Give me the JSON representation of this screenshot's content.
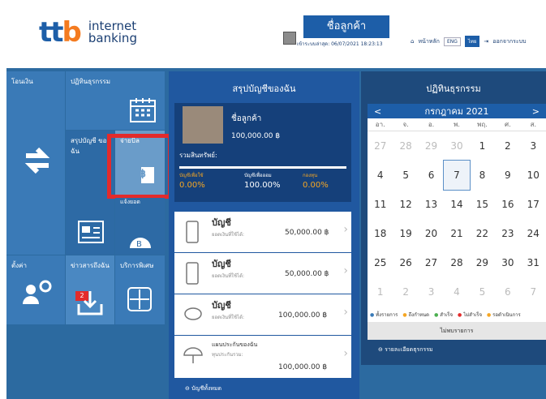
{
  "header": {
    "logo_main": "ttb",
    "logo_sub1": "internet",
    "logo_sub2": "banking",
    "customer_name": "ชื่อลูกค้า",
    "last_login": "เข้าระบบล่าสุด: 06/07/2021 18:23:13",
    "home": "หน้าหลัก",
    "lang_en": "ENG",
    "lang_th": "ไทย",
    "logout": "ออกจากระบบ"
  },
  "tiles": {
    "transfer": "โอนเงิน",
    "transactions": "ปฏิทินธุรกรรม",
    "summary": "สรุปบัญชี ของฉัน",
    "paybill": "จ่ายบิล",
    "settings": "ตั้งค่า",
    "news": "ข่าวสารถึงฉัน",
    "services": "บริการพิเศษ",
    "news_badge": "2",
    "partial": "แจ้งยอด"
  },
  "summary": {
    "title": "สรุปบัญชีของฉัน",
    "name": "ชื่อลูกค้า",
    "amount": "100,000.00 ฿",
    "assets_label": "รวมสินทรัพย์:",
    "c1": "บัญชีเพื่อใช้",
    "c2": "บัญชีเพื่อออม",
    "c3": "กองทุน",
    "p1": "0.00%",
    "p2": "100.00%",
    "p3": "0.00%",
    "accounts": [
      {
        "title": "บัญชี",
        "sub": "ยอดเงินที่ใช้ได้:",
        "amt": "50,000.00 ฿"
      },
      {
        "title": "บัญชี",
        "sub": "ยอดเงินที่ใช้ได้:",
        "amt": "50,000.00 ฿"
      },
      {
        "title": "บัญชี",
        "sub": "ยอดเงินที่ใช้ได้:",
        "amt": "100,000.00 ฿"
      },
      {
        "title": "แผนประกันของฉัน",
        "sub": "ทุนประกันรวม:",
        "amt": "100,000.00 ฿"
      }
    ],
    "all_accounts": "บัญชีทั้งหมด"
  },
  "calendar": {
    "title": "ปฏิทินธุรกรรม",
    "month": "กรกฎาคม 2021",
    "prev": "<",
    "next": ">",
    "dows": [
      "อา.",
      "จ.",
      "อ.",
      "พ.",
      "พฤ.",
      "ศ.",
      "ส."
    ],
    "days": [
      "27",
      "28",
      "29",
      "30",
      "1",
      "2",
      "3",
      "4",
      "5",
      "6",
      "7",
      "8",
      "9",
      "10",
      "11",
      "12",
      "13",
      "14",
      "15",
      "16",
      "17",
      "18",
      "19",
      "20",
      "21",
      "22",
      "23",
      "24",
      "25",
      "26",
      "27",
      "28",
      "29",
      "30",
      "31",
      "1",
      "2",
      "3",
      "4",
      "5",
      "6",
      "7"
    ],
    "legend": [
      "ทั้งรายการ",
      "ถึงกำหนด",
      "สำเร็จ",
      "ไม่สำเร็จ",
      "รอดำเนินการ"
    ],
    "no_list": "ไม่พบรายการ",
    "details": "รายละเอียดธุรกรรม"
  },
  "colors": {
    "accent": "#1d5ea8",
    "orange": "#f47b20",
    "highlight": "#e32b2b"
  }
}
